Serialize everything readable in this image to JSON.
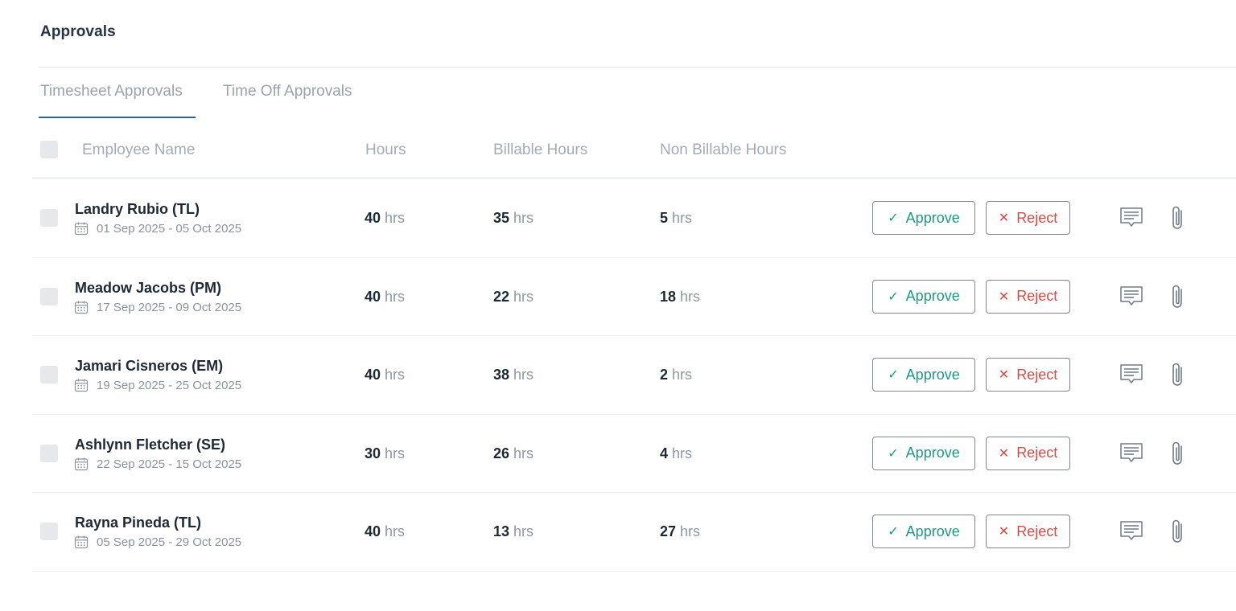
{
  "page": {
    "title": "Approvals"
  },
  "tabs": [
    {
      "label": "Timesheet Approvals",
      "active": true
    },
    {
      "label": "Time Off Approvals",
      "active": false
    }
  ],
  "table": {
    "columns": {
      "name": "Employee Name",
      "hours": "Hours",
      "billable": "Billable Hours",
      "non_billable": "Non Billable Hours"
    },
    "unit": "hrs",
    "rows": [
      {
        "name": "Landry Rubio (TL)",
        "dates": "01 Sep 2025 - 05 Oct 2025",
        "hours": "40",
        "billable": "35",
        "non_billable": "5"
      },
      {
        "name": "Meadow Jacobs (PM)",
        "dates": "17 Sep 2025 - 09 Oct 2025",
        "hours": "40",
        "billable": "22",
        "non_billable": "18"
      },
      {
        "name": "Jamari Cisneros (EM)",
        "dates": "19 Sep 2025 - 25 Oct 2025",
        "hours": "40",
        "billable": "38",
        "non_billable": "2"
      },
      {
        "name": "Ashlynn Fletcher (SE)",
        "dates": "22 Sep 2025 - 15 Oct 2025",
        "hours": "30",
        "billable": "26",
        "non_billable": "4"
      },
      {
        "name": "Rayna Pineda (TL)",
        "dates": "05 Sep 2025 - 29 Oct 2025",
        "hours": "40",
        "billable": "13",
        "non_billable": "27"
      }
    ]
  },
  "actions": {
    "approve_label": "Approve",
    "reject_label": "Reject",
    "approve_glyph": "✓",
    "reject_glyph": "✕",
    "approve_color": "#1a9a84",
    "reject_color": "#d84b45"
  },
  "icons": {
    "date": "calendar-icon",
    "comment": "comment-icon",
    "attachment": "paperclip-icon"
  },
  "colors": {
    "tab_active_underline": "#2c6595",
    "icon_gray": "#6f7b87"
  }
}
